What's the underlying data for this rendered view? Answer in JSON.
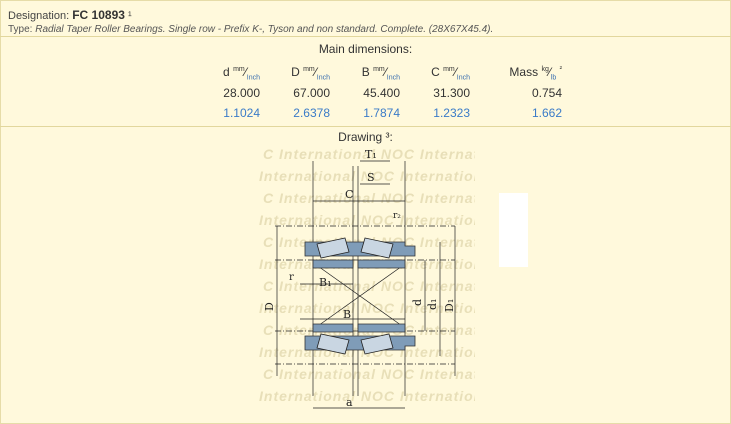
{
  "header": {
    "designation_label": "Designation:",
    "designation_value": "FC 10893",
    "designation_note": "¹",
    "type_label": "Type:",
    "type_value": "Radial Taper Roller Bearings. Single row - Prefix K-, Tyson and non standard. Complete. (28X67X45.4)."
  },
  "dimensions": {
    "title": "Main dimensions:",
    "columns": [
      {
        "symbol": "d",
        "unit_top": "mm",
        "unit_bottom": "Inch"
      },
      {
        "symbol": "D",
        "unit_top": "mm",
        "unit_bottom": "Inch"
      },
      {
        "symbol": "B",
        "unit_top": "mm",
        "unit_bottom": "Inch"
      },
      {
        "symbol": "C",
        "unit_top": "mm",
        "unit_bottom": "Inch"
      },
      {
        "symbol": "Mass",
        "unit_top": "kg",
        "unit_bottom": "lb",
        "note": "²"
      }
    ],
    "mm_values": [
      "28.000",
      "67.000",
      "45.400",
      "31.300",
      "0.754"
    ],
    "inch_values": [
      "1.1024",
      "2.6378",
      "1.7874",
      "1.2323",
      "1.662"
    ]
  },
  "drawing": {
    "title": "Drawing ³:",
    "watermark": "C International NOC International",
    "labels": {
      "T1": "T₁",
      "S": "S",
      "C": "C",
      "r2": "r₂",
      "r": "r",
      "B1": "B₁",
      "B": "B",
      "D": "D",
      "d": "d",
      "d1": "d₁",
      "D1": "D₁",
      "a": "a"
    }
  },
  "colors": {
    "background": "#fff9dc",
    "accent": "#3a7bc8",
    "steel": "#7f9cb8"
  }
}
